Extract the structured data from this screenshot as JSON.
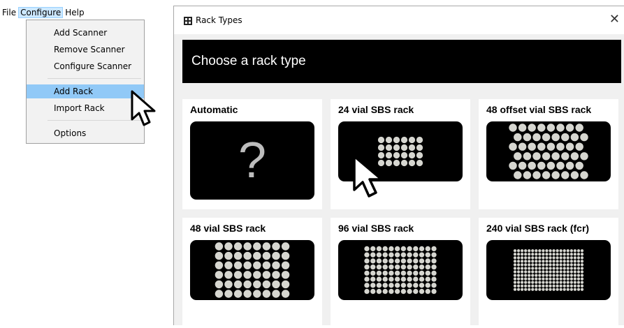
{
  "menubar": {
    "items": [
      "File",
      "Configure",
      "Help"
    ]
  },
  "configure_menu": {
    "items": [
      {
        "label": "Add Scanner",
        "highlighted": false
      },
      {
        "label": "Remove Scanner",
        "highlighted": false
      },
      {
        "label": "Configure Scanner",
        "highlighted": false
      },
      {
        "label": "Add Rack",
        "highlighted": true
      },
      {
        "label": "Import Rack",
        "highlighted": false
      },
      {
        "label": "Options",
        "highlighted": false
      }
    ]
  },
  "dialog": {
    "title": "Rack Types",
    "close_glyph": "✕",
    "banner": "Choose a rack type",
    "cards": [
      {
        "label": "Automatic",
        "preview": "question-mark",
        "glyph": "?"
      },
      {
        "label": "24 vial SBS rack",
        "preview": "grid",
        "cols": 6,
        "rows": 4,
        "offset": false
      },
      {
        "label": "48 offset vial SBS rack",
        "preview": "grid",
        "cols": 8,
        "rows": 6,
        "offset": true
      },
      {
        "label": "48 vial SBS rack",
        "preview": "grid",
        "cols": 8,
        "rows": 6,
        "offset": false
      },
      {
        "label": "96 vial SBS rack",
        "preview": "grid",
        "cols": 12,
        "rows": 8,
        "offset": false
      },
      {
        "label": "240 vial SBS rack (fcr)",
        "preview": "grid",
        "cols": 20,
        "rows": 12,
        "offset": false
      }
    ]
  },
  "colors": {
    "menu_highlight": "#91c9f7",
    "dot": "#d6d6d0",
    "banner_bg": "#000000"
  }
}
